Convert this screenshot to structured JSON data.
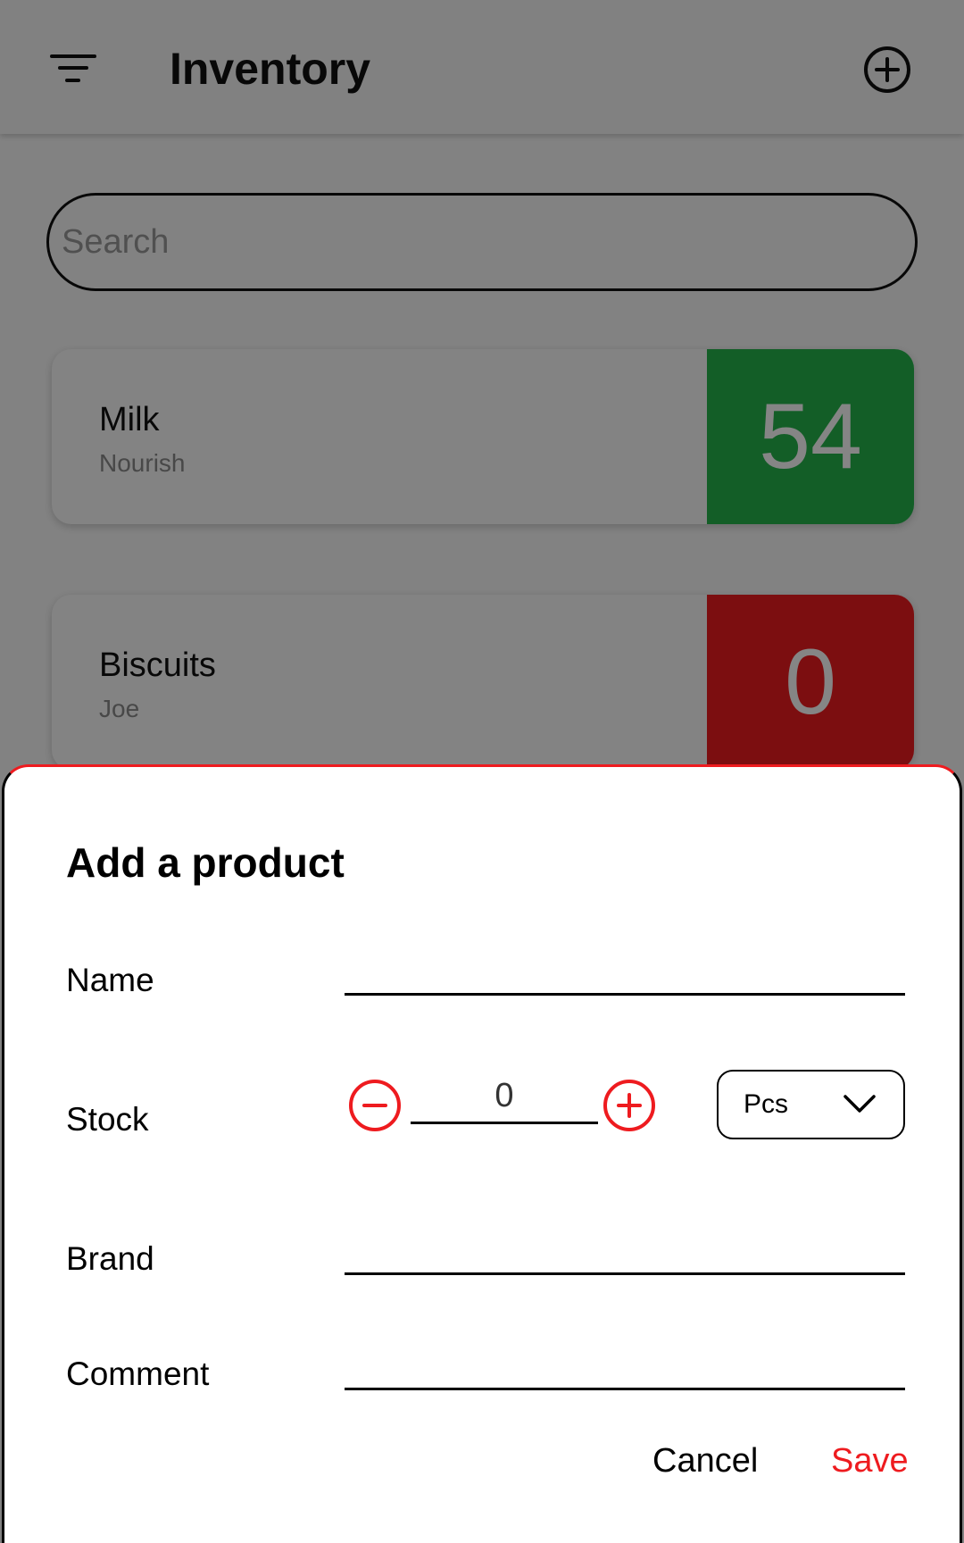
{
  "app_bar": {
    "title": "Inventory",
    "menu_icon": "filter-list-icon",
    "add_icon": "add-circle-icon"
  },
  "search": {
    "placeholder": "Search",
    "value": ""
  },
  "products": [
    {
      "name": "Milk",
      "brand": "Nourish",
      "stock": "54",
      "status_color": "#26b54b"
    },
    {
      "name": "Biscuits",
      "brand": "Joe",
      "stock": "0",
      "status_color": "#ee1b1f"
    }
  ],
  "dialog": {
    "title": "Add a product",
    "name_label": "Name",
    "name_value": "",
    "stock_label": "Stock",
    "stock_value": "0",
    "decrement_icon": "minus-circle-icon",
    "increment_icon": "plus-circle-icon",
    "unit_value": "Pcs",
    "unit_icon": "chevron-down-icon",
    "brand_label": "Brand",
    "brand_value": "",
    "comment_label": "Comment",
    "comment_value": "",
    "cancel_label": "Cancel",
    "save_label": "Save"
  },
  "colors": {
    "accent": "#ee1b1f",
    "in_stock": "#26b54b",
    "out_of_stock": "#ee1b1f"
  }
}
